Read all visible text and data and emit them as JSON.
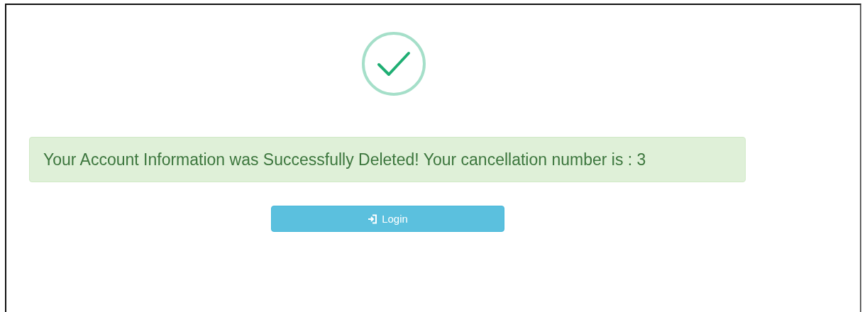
{
  "alert": {
    "message": "Your Account Information was Successfully Deleted! Your cancellation number is : 3"
  },
  "button": {
    "label": "Login"
  }
}
